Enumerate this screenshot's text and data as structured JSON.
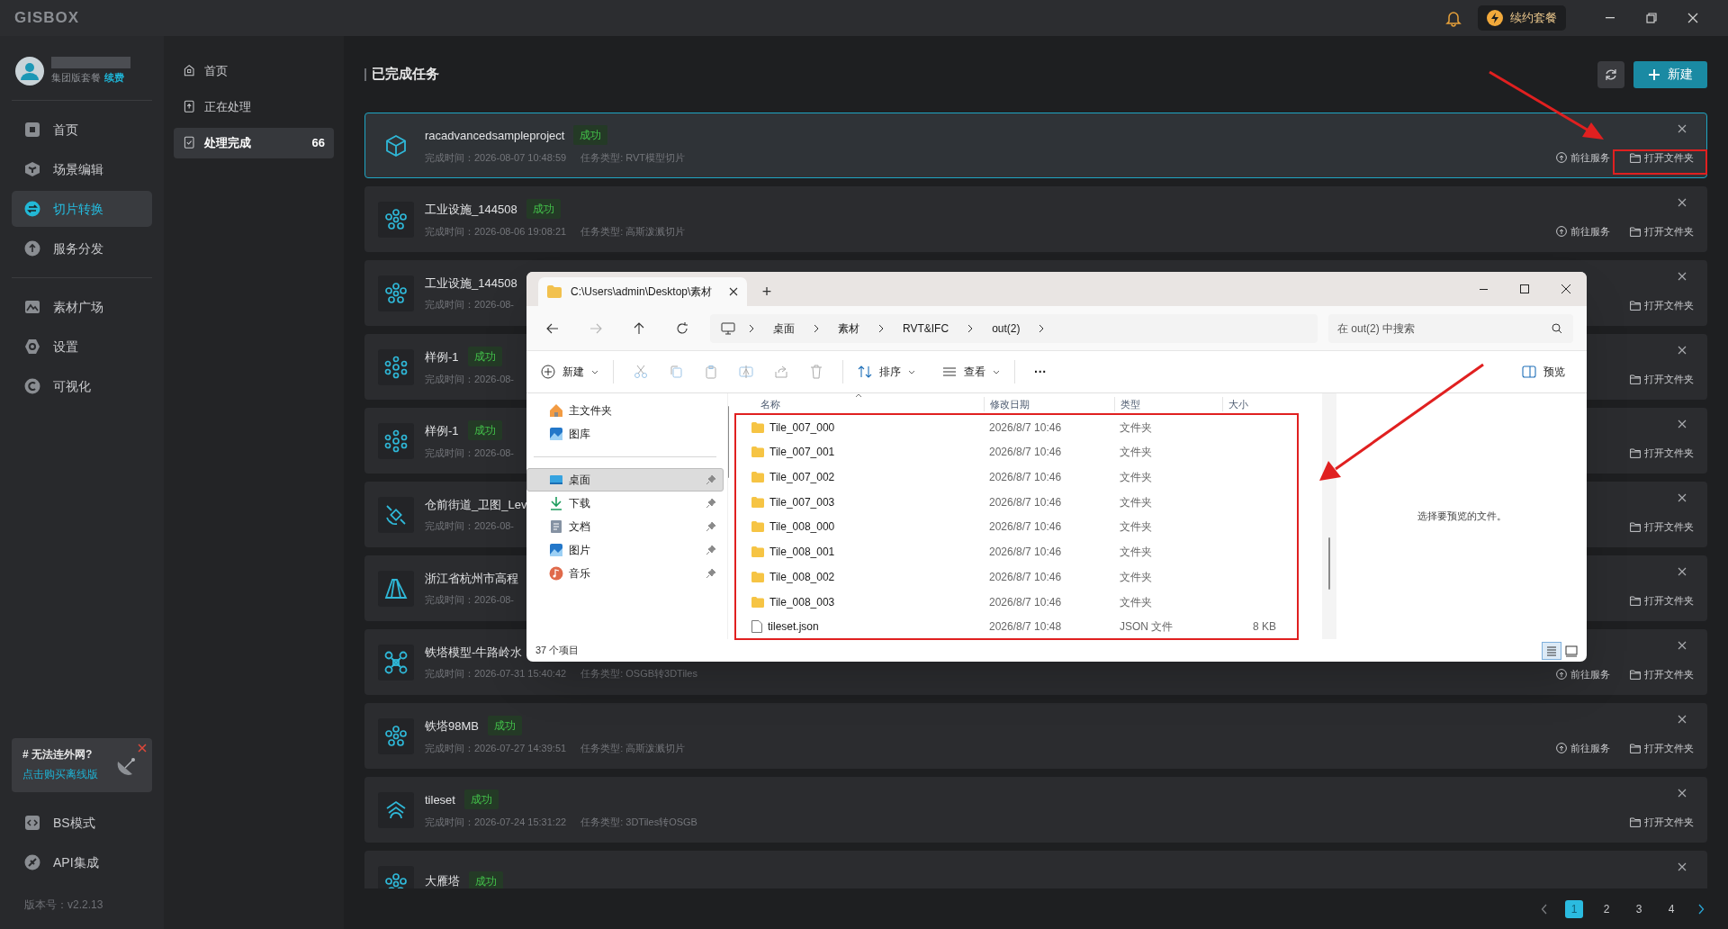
{
  "app": {
    "logo": "GISBOX",
    "plan_button": "续约套餐"
  },
  "user": {
    "plan": "集团版套餐",
    "renew": "续费"
  },
  "sidebar": {
    "groups": [
      [
        {
          "label": "首页",
          "kind": "home",
          "selected": false
        },
        {
          "label": "场景编辑",
          "kind": "cube",
          "selected": false
        },
        {
          "label": "切片转换",
          "kind": "swap",
          "selected": true
        },
        {
          "label": "服务分发",
          "kind": "upload",
          "selected": false
        }
      ],
      [
        {
          "label": "素材广场",
          "kind": "mountain",
          "selected": false
        },
        {
          "label": "设置",
          "kind": "gear",
          "selected": false
        },
        {
          "label": "可视化",
          "kind": "chart",
          "selected": false
        }
      ]
    ],
    "promo": {
      "title": "# 无法连外网?",
      "link": "点击购买离线版"
    },
    "bottom_items": [
      {
        "label": "BS模式",
        "kind": "code"
      },
      {
        "label": "API集成",
        "kind": "plug"
      }
    ],
    "version": "版本号：v2.2.13"
  },
  "subnav": [
    {
      "label": "首页",
      "kind": "home",
      "selected": false
    },
    {
      "label": "正在处理",
      "kind": "upload",
      "selected": false
    },
    {
      "label": "处理完成",
      "kind": "check",
      "selected": true,
      "count": "66"
    }
  ],
  "main": {
    "title": "已完成任务",
    "new_button": "新建",
    "tasks": [
      {
        "kind": "cube",
        "title": "racadvancedsampleproject",
        "badge": "成功",
        "completed": "完成时间：2026-08-07 10:48:59",
        "type": "任务类型: RVT模型切片",
        "selected": true,
        "actions": [
          "前往服务",
          "打开文件夹"
        ]
      },
      {
        "kind": "splat",
        "title": "工业设施_144508",
        "badge": "成功",
        "completed": "完成时间：2026-08-06 19:08:21",
        "type": "任务类型: 高斯泼溅切片",
        "selected": false,
        "actions": [
          "前往服务",
          "打开文件夹"
        ]
      },
      {
        "kind": "splat",
        "title": "工业设施_144508",
        "completed": "完成时间：2026-08-",
        "selected": false,
        "actions": [
          "打开文件夹"
        ]
      },
      {
        "kind": "nodes",
        "title": "样例-1",
        "badge": "成功",
        "completed": "完成时间：2026-08-",
        "selected": false,
        "actions": [
          "打开文件夹"
        ]
      },
      {
        "kind": "nodes",
        "title": "样例-1",
        "badge": "成功",
        "completed": "完成时间：2026-08-",
        "selected": false,
        "actions": [
          "打开文件夹"
        ]
      },
      {
        "kind": "satellite",
        "title": "仓前街道_卫图_Lev",
        "completed": "完成时间：2026-08-",
        "selected": false,
        "actions": [
          "打开文件夹"
        ]
      },
      {
        "kind": "terrain",
        "title": "浙江省杭州市高程",
        "completed": "完成时间：2026-08-",
        "selected": false,
        "actions": [
          "打开文件夹"
        ]
      },
      {
        "kind": "drone",
        "title": "铁塔模型-牛路岭水",
        "completed": "完成时间：2026-07-31 15:40:42",
        "type": "任务类型: OSGB转3DTiles",
        "selected": false,
        "actions": [
          "前往服务",
          "打开文件夹"
        ]
      },
      {
        "kind": "splat",
        "title": "铁塔98MB",
        "badge": "成功",
        "completed": "完成时间：2026-07-27 14:39:51",
        "type": "任务类型: 高斯泼溅切片",
        "selected": false,
        "actions": [
          "前往服务",
          "打开文件夹"
        ]
      },
      {
        "kind": "tileset",
        "title": "tileset",
        "badge": "成功",
        "completed": "完成时间：2026-07-24 15:31:22",
        "type": "任务类型: 3DTiles转OSGB",
        "selected": false,
        "actions": [
          "打开文件夹"
        ]
      },
      {
        "kind": "splat",
        "title": "大雁塔",
        "badge": "成功",
        "selected": false
      }
    ],
    "pages": [
      {
        "label": "1",
        "selected": true
      },
      {
        "label": "2",
        "selected": false
      },
      {
        "label": "3",
        "selected": false
      },
      {
        "label": "4",
        "selected": false
      }
    ]
  },
  "explorer": {
    "tab_title": "C:\\Users\\admin\\Desktop\\素材",
    "tab_add": "+",
    "breadcrumb": [
      "桌面",
      "素材",
      "RVT&IFC",
      "out(2)"
    ],
    "search_placeholder": "在 out(2) 中搜索",
    "toolbar": {
      "new": "新建",
      "sort": "排序",
      "view": "查看",
      "more": "···",
      "preview": "预览"
    },
    "nav": [
      {
        "label": "主文件夹",
        "kind": "home",
        "selected": false,
        "pinned": false
      },
      {
        "label": "图库",
        "kind": "gallery",
        "selected": false,
        "pinned": false
      },
      {
        "label": "桌面",
        "kind": "desktop",
        "selected": true,
        "pinned": true
      },
      {
        "label": "下载",
        "kind": "download",
        "selected": false,
        "pinned": true
      },
      {
        "label": "文档",
        "kind": "document",
        "selected": false,
        "pinned": true
      },
      {
        "label": "图片",
        "kind": "gallery",
        "selected": false,
        "pinned": true
      },
      {
        "label": "音乐",
        "kind": "music",
        "selected": false,
        "pinned": true
      }
    ],
    "columns": [
      "名称",
      "修改日期",
      "类型",
      "大小"
    ],
    "files": [
      {
        "kind": "folder",
        "name": "Tile_007_000",
        "date": "2026/8/7 10:46",
        "type": "文件夹"
      },
      {
        "kind": "folder",
        "name": "Tile_007_001",
        "date": "2026/8/7 10:46",
        "type": "文件夹"
      },
      {
        "kind": "folder",
        "name": "Tile_007_002",
        "date": "2026/8/7 10:46",
        "type": "文件夹"
      },
      {
        "kind": "folder",
        "name": "Tile_007_003",
        "date": "2026/8/7 10:46",
        "type": "文件夹"
      },
      {
        "kind": "folder",
        "name": "Tile_008_000",
        "date": "2026/8/7 10:46",
        "type": "文件夹"
      },
      {
        "kind": "folder",
        "name": "Tile_008_001",
        "date": "2026/8/7 10:46",
        "type": "文件夹"
      },
      {
        "kind": "folder",
        "name": "Tile_008_002",
        "date": "2026/8/7 10:46",
        "type": "文件夹"
      },
      {
        "kind": "folder",
        "name": "Tile_008_003",
        "date": "2026/8/7 10:46",
        "type": "文件夹"
      },
      {
        "kind": "file",
        "name": "tileset.json",
        "date": "2026/8/7 10:48",
        "type": "JSON 文件",
        "size": "8 KB"
      }
    ],
    "status": "37 个项目",
    "preview_message": "选择要预览的文件。",
    "view_modes": [
      {
        "kind": "details",
        "selected": true
      },
      {
        "kind": "tiles",
        "selected": false
      }
    ]
  }
}
